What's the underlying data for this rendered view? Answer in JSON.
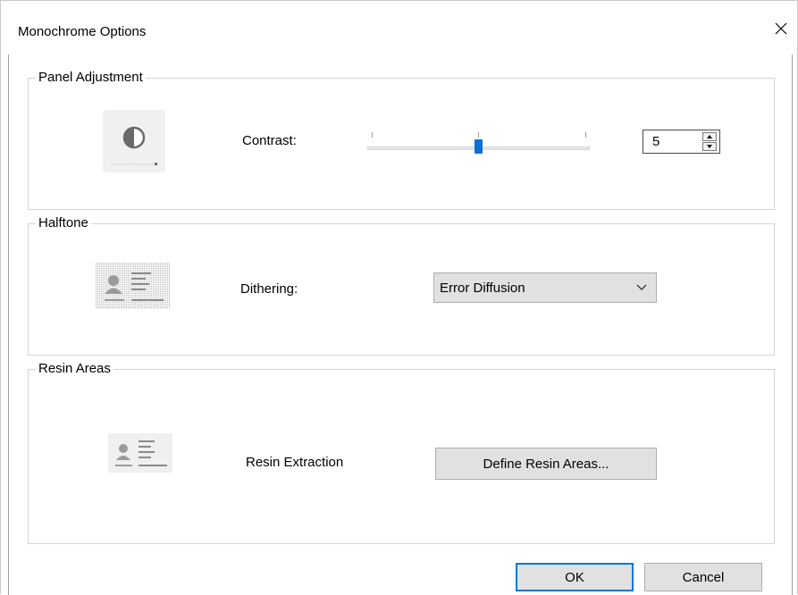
{
  "dialog": {
    "title": "Monochrome Options",
    "close_icon": "close-icon"
  },
  "panel_adjustment": {
    "group_label": "Panel Adjustment",
    "icon": "contrast-icon",
    "contrast_label": "Contrast:",
    "contrast_value": "5"
  },
  "halftone": {
    "group_label": "Halftone",
    "icon": "id-card-halftone-icon",
    "dithering_label": "Dithering:",
    "dithering_selected": "Error Diffusion"
  },
  "resin_areas": {
    "group_label": "Resin Areas",
    "icon": "id-card-icon",
    "resin_label": "Resin Extraction",
    "define_button": "Define Resin Areas..."
  },
  "footer": {
    "ok_label": "OK",
    "cancel_label": "Cancel"
  }
}
